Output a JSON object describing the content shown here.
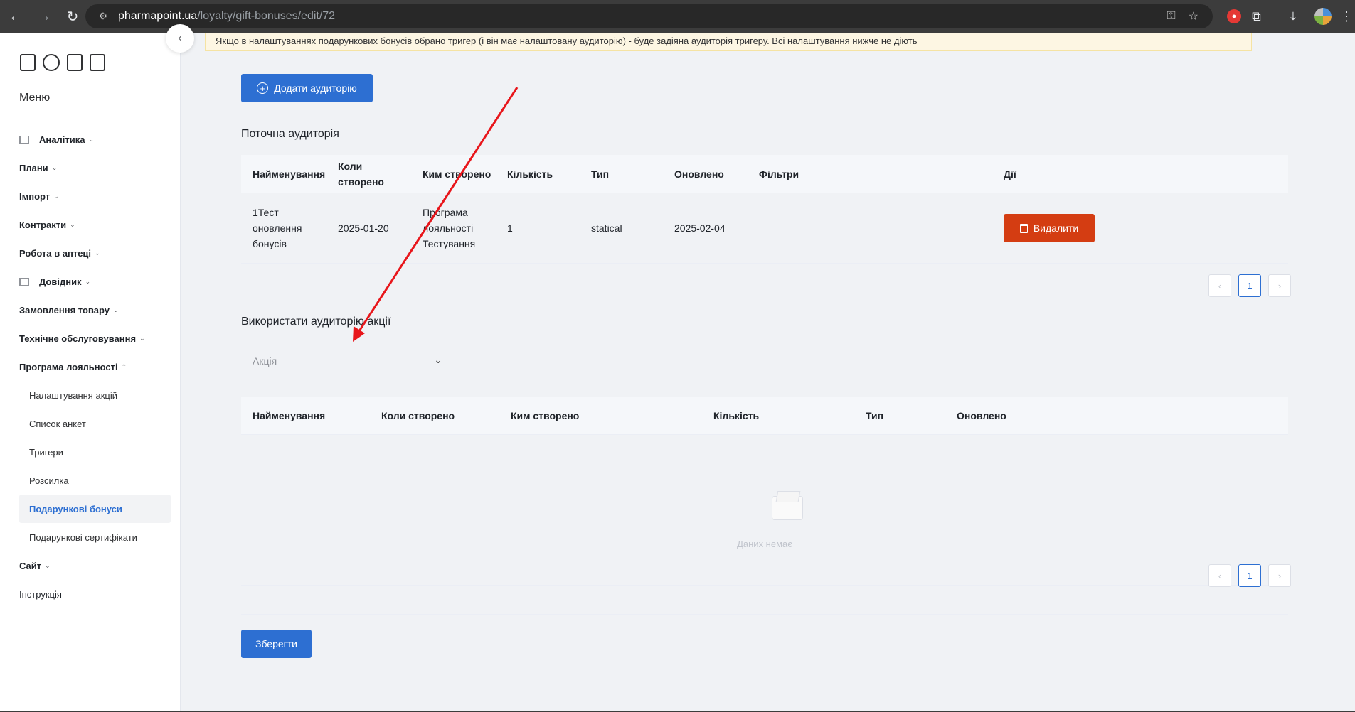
{
  "browser": {
    "url_host": "pharmapoint.ua",
    "url_path": "/loyalty/gift-bonuses/edit/72"
  },
  "sidebar": {
    "menu_title": "Меню",
    "items": [
      {
        "label": "Аналітика",
        "has_icon": true,
        "caret": "⌄"
      },
      {
        "label": "Плани",
        "caret": "⌄"
      },
      {
        "label": "Імпорт",
        "caret": "⌄"
      },
      {
        "label": "Контракти",
        "caret": "⌄"
      },
      {
        "label": "Робота в аптеці",
        "caret": "⌄"
      },
      {
        "label": "Довідник",
        "has_icon": true,
        "caret": "⌄"
      },
      {
        "label": "Замовлення товару",
        "caret": "⌄"
      },
      {
        "label": "Технічне обслуговування",
        "caret": "⌄"
      },
      {
        "label": "Програма лояльності",
        "caret": "⌃"
      }
    ],
    "sub_items": [
      "Налаштування акцій",
      "Список анкет",
      "Тригери",
      "Розсилка",
      "Подарункові бонуси",
      "Подарункові сертифікати"
    ],
    "active_sub": "Подарункові бонуси",
    "after_items": [
      {
        "label": "Сайт",
        "caret": "⌄"
      },
      {
        "label": "Інструкція"
      }
    ]
  },
  "main": {
    "notice": "Якщо в налаштуваннях подарункових бонусів обрано тригер (і він має налаштовану аудиторію) - буде задіяна аудиторія тригеру. Всі налаштування нижче не діють",
    "add_audience_button": "Додати аудиторію",
    "current_audience_title": "Поточна аудиторія",
    "current_table": {
      "columns": [
        "Найменування",
        "Коли створено",
        "Ким створено",
        "Кількість",
        "Тип",
        "Оновлено",
        "Фільтри",
        "Дії"
      ],
      "rows": [
        {
          "name": "1Тест оновлення бонусів",
          "created": "2025-01-20",
          "created_by": "Програма лояльності Тестування",
          "count": "1",
          "type": "statical",
          "updated": "2025-02-04",
          "filters": "",
          "action": "Видалити"
        }
      ]
    },
    "pager1": {
      "current": "1",
      "prev": "‹",
      "next": "›"
    },
    "use_audience_title": "Використати аудиторію акції",
    "select": {
      "placeholder": "Акція"
    },
    "promo_table": {
      "columns": [
        "Найменування",
        "Коли створено",
        "Ким створено",
        "Кількість",
        "Тип",
        "Оновлено"
      ],
      "empty_text": "Даних немає"
    },
    "pager2": {
      "current": "1",
      "prev": "‹",
      "next": "›"
    },
    "save_button": "Зберегти"
  },
  "colors": {
    "primary": "#2d6fd2",
    "danger": "#d43d12",
    "annotation_arrow": "#e8161b"
  }
}
